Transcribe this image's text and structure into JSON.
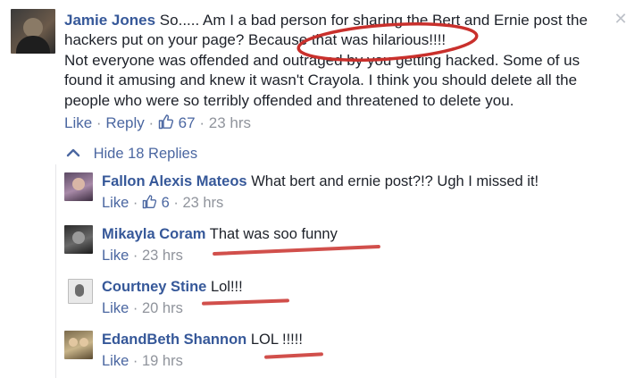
{
  "main_comment": {
    "author": "Jamie Jones",
    "text_line1_rest": "So..... Am I a bad person for sharing the Bert and Ernie post the",
    "text_line2": "hackers put on your page? Because that was hilarious!!!!",
    "text_para2": "Not everyone was offended and outraged by you getting hacked. Some of us found it amusing and knew it wasn't Crayola. I think you should delete all the people who were so terribly offended and threatened to delete you.",
    "like_label": "Like",
    "sep": "·",
    "reply_label": "Reply",
    "like_count": "67",
    "time": "23 hrs",
    "close_glyph": "✕"
  },
  "replies_toggle": {
    "chevron": "^",
    "label": "Hide 18 Replies"
  },
  "replies": [
    {
      "author": "Fallon Alexis Mateos",
      "text": "What bert and ernie post?!? Ugh I missed it!",
      "like_label": "Like",
      "sep": "·",
      "like_count": "6",
      "time": "23 hrs"
    },
    {
      "author": "Mikayla Coram",
      "text": "That was soo funny",
      "like_label": "Like",
      "sep": "·",
      "time": "23 hrs"
    },
    {
      "author": "Courtney Stine",
      "text": "Lol!!!",
      "like_label": "Like",
      "sep": "·",
      "time": "20 hrs"
    },
    {
      "author": "EdandBeth Shannon",
      "text": "LOL !!!!!",
      "like_label": "Like",
      "sep": "·",
      "time": "19 hrs"
    }
  ],
  "annotation_color": "#c9302c"
}
